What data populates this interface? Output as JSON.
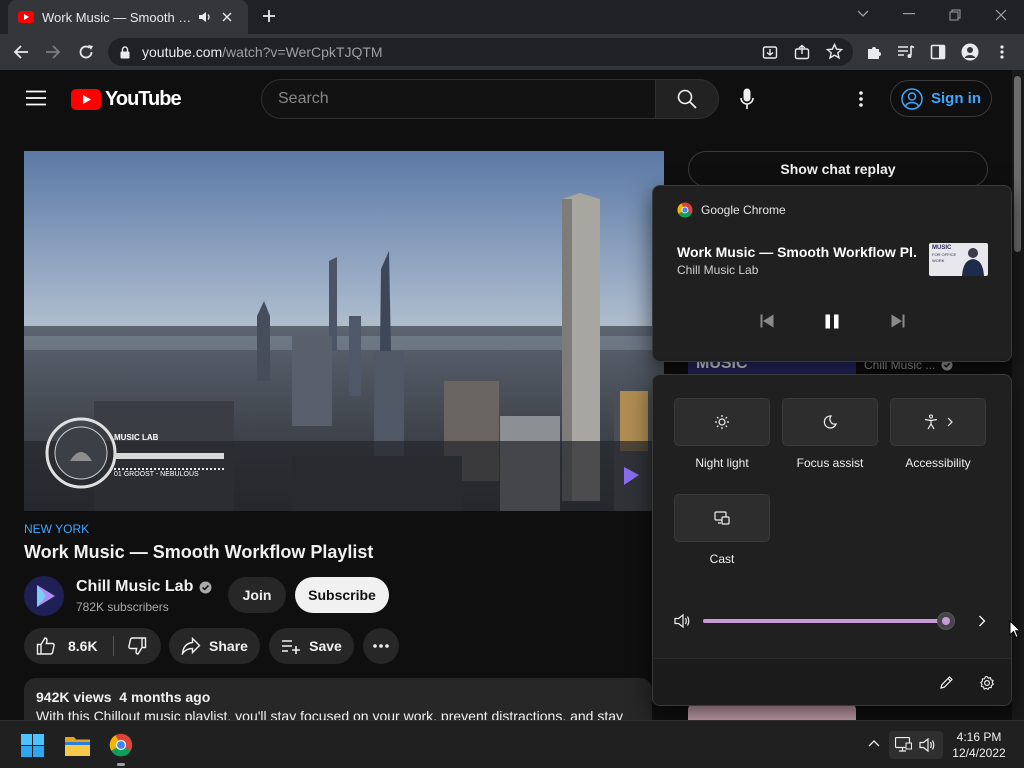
{
  "browser": {
    "tab_title": "Work Music — Smooth Workflow Playlist",
    "url_host": "youtube.com",
    "url_path": "/watch?v=WerCpkTJQTM"
  },
  "youtube": {
    "brand": "YouTube",
    "search_placeholder": "Search",
    "signin_label": "Sign in",
    "chat_replay_label": "Show chat replay",
    "video_overlay": {
      "logo_text": "MUSIC LAB",
      "track_text": "01 GROOST - NEBULOUS"
    },
    "hashtag": "NEW YORK",
    "title": "Work Music — Smooth Workflow Playlist",
    "channel": {
      "name": "Chill Music Lab",
      "subscribers": "782K subscribers",
      "join_label": "Join",
      "subscribe_label": "Subscribe"
    },
    "actions": {
      "likes": "8.6K",
      "share_label": "Share",
      "save_label": "Save"
    },
    "description": {
      "stats": "942K views  4 months ago",
      "text": "With this Chillout music playlist, you'll stay focused on your work, prevent distractions, and stay"
    },
    "sidebar_peek": {
      "thumb_text": "MUSIC",
      "channel_name": "Chill Music ..."
    }
  },
  "media_flyout": {
    "app_name": "Google Chrome",
    "track_title": "Work Music — Smooth Workflow Pl...",
    "artist": "Chill Music Lab",
    "thumb_text_1": "MUSIC",
    "thumb_text_2": "FOR OFFICE",
    "thumb_text_3": "WORK"
  },
  "quick_settings": {
    "tiles": [
      {
        "label": "Night light",
        "icon": "brightness-icon"
      },
      {
        "label": "Focus assist",
        "icon": "moon-icon"
      },
      {
        "label": "Accessibility",
        "icon": "accessibility-icon"
      },
      {
        "label": "Cast",
        "icon": "cast-icon"
      }
    ],
    "volume_level": 0.97,
    "accent_color": "#c89bd8"
  },
  "taskbar": {
    "time": "4:16 PM",
    "date": "12/4/2022"
  }
}
